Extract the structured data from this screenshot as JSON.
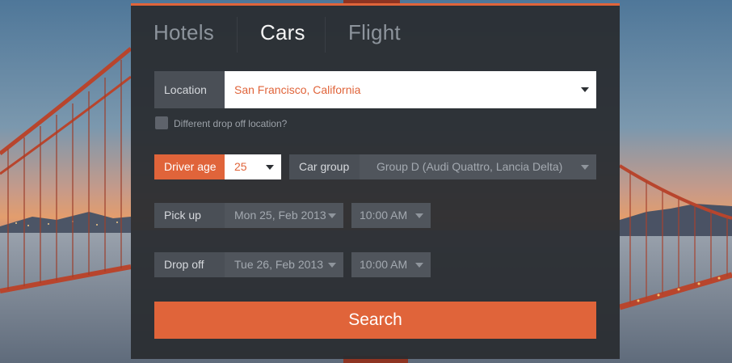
{
  "tabs": [
    {
      "label": "Hotels",
      "active": false
    },
    {
      "label": "Cars",
      "active": true
    },
    {
      "label": "Flight",
      "active": false
    }
  ],
  "location": {
    "label": "Location",
    "value": "San Francisco, California"
  },
  "different_dropoff": {
    "label": "Different drop off location?",
    "checked": false
  },
  "driver_age": {
    "label": "Driver age",
    "value": "25"
  },
  "car_group": {
    "label": "Car group",
    "value": "Group D (Audi Quattro, Lancia Delta)"
  },
  "pickup": {
    "label": "Pick up",
    "date": "Mon 25, Feb 2013",
    "time": "10:00 AM"
  },
  "dropoff": {
    "label": "Drop off",
    "date": "Tue 26, Feb 2013",
    "time": "10:00 AM"
  },
  "search_button": {
    "label": "Search"
  },
  "colors": {
    "accent": "#e0643a",
    "panel": "#2a2d32",
    "field": "#4a4f56",
    "location_text": "#e0643a"
  },
  "icons": {
    "dropdown": "caret-down-icon",
    "checkbox": "checkbox-icon"
  }
}
